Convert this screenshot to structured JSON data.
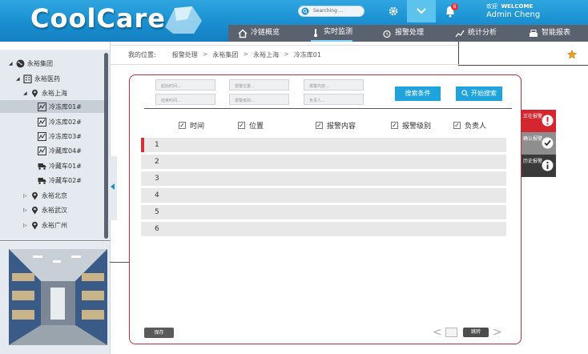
{
  "app": {
    "logo": "CoolCare"
  },
  "search": {
    "placeholder": "Searching ..."
  },
  "notifications": {
    "count": "6"
  },
  "user": {
    "welcome_cn": "欢迎",
    "welcome_en": "WELCOME",
    "name": "Admin Cheng"
  },
  "nav": {
    "items": [
      {
        "label": "冷链概览",
        "icon": "home-icon"
      },
      {
        "label": "实时监测",
        "icon": "thermometer-icon"
      },
      {
        "label": "报警处理",
        "icon": "alarm-clock-icon"
      },
      {
        "label": "统计分析",
        "icon": "trend-chart-icon"
      },
      {
        "label": "智能报表",
        "icon": "printer-icon"
      }
    ],
    "active": "实时监测"
  },
  "sidebar": {
    "tree": [
      {
        "label": "永裕集团",
        "icon": "globe-icon",
        "level": 0,
        "expanded": true
      },
      {
        "label": "永裕医药",
        "icon": "building-icon",
        "level": 1,
        "expanded": true
      },
      {
        "label": "永裕上海",
        "icon": "location-pin-icon",
        "level": 2,
        "expanded": true
      },
      {
        "label": "冷冻库01#",
        "icon": "chart-icon",
        "level": 3,
        "selected": true
      },
      {
        "label": "冷冻库02#",
        "icon": "chart-icon",
        "level": 3
      },
      {
        "label": "冷冻库03#",
        "icon": "chart-icon",
        "level": 3
      },
      {
        "label": "冷藏库04#",
        "icon": "chart-icon",
        "level": 3
      },
      {
        "label": "冷藏车01#",
        "icon": "truck-icon",
        "level": 3
      },
      {
        "label": "冷藏车02#",
        "icon": "truck-icon",
        "level": 3
      },
      {
        "label": "永裕北京",
        "icon": "location-pin-icon",
        "level": 2
      },
      {
        "label": "永裕武汉",
        "icon": "location-pin-icon",
        "level": 2
      },
      {
        "label": "永裕广州",
        "icon": "location-pin-icon",
        "level": 2
      }
    ]
  },
  "breadcrumb": {
    "prefix": "我的位置:",
    "items": [
      "报警处理",
      "永裕集团",
      "永裕上海",
      "冷冻库01"
    ],
    "separator": ">"
  },
  "filters": {
    "fields": [
      {
        "placeholder": "起始时间..."
      },
      {
        "placeholder": "报警位置..."
      },
      {
        "placeholder": "报警内容..."
      },
      {
        "placeholder": "结束时间..."
      },
      {
        "placeholder": "报警级别..."
      },
      {
        "placeholder": "负责人..."
      }
    ],
    "search_conditions_label": "搜索条件",
    "start_search_label": "开始搜索"
  },
  "columns": [
    {
      "label": "时间",
      "checked": true
    },
    {
      "label": "位置",
      "checked": true
    },
    {
      "label": "报警内容",
      "checked": true
    },
    {
      "label": "报警级别",
      "checked": true
    },
    {
      "label": "负责人",
      "checked": true
    }
  ],
  "rows": [
    "1",
    "2",
    "3",
    "4",
    "5",
    "6"
  ],
  "footer": {
    "save_label": "保存",
    "jump_label": "跳转",
    "prev": "<",
    "next": ">"
  },
  "status_tabs": [
    {
      "label": "正在报警",
      "color": "#d3262f",
      "icon": "alert-icon"
    },
    {
      "label": "确认报警",
      "color": "#8e8e8e",
      "icon": "check-icon"
    },
    {
      "label": "历史报警",
      "color": "#3a3a3a",
      "icon": "info-icon"
    }
  ],
  "colors": {
    "header": "#1a8fd0",
    "accent": "#1ea3dd",
    "alert": "#d3262f",
    "panel_border": "#b8323a"
  }
}
